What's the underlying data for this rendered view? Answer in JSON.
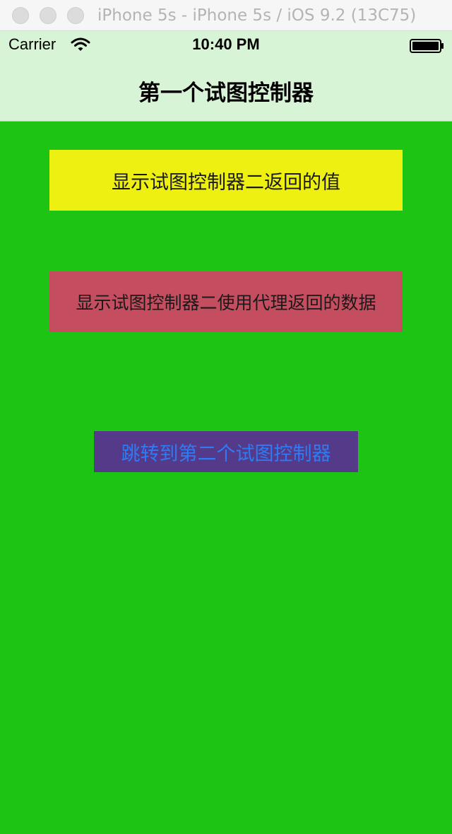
{
  "window": {
    "title": "iPhone 5s - iPhone 5s / iOS 9.2 (13C75)"
  },
  "status_bar": {
    "carrier": "Carrier",
    "time": "10:40 PM",
    "icons": [
      "wifi-icon",
      "battery-icon"
    ]
  },
  "nav": {
    "title": "第一个试图控制器"
  },
  "buttons": {
    "show_return_value": "显示试图控制器二返回的值",
    "show_delegate_data": "显示试图控制器二使用代理返回的数据",
    "goto_second": "跳转到第二个试图控制器"
  },
  "colors": {
    "background": "#1dc414",
    "nav_background": "#d8f4d6",
    "yellow_button": "#eef011",
    "red_button": "#c44e5f",
    "purple_button": "#543a88",
    "link_text": "#2d7cf6"
  }
}
